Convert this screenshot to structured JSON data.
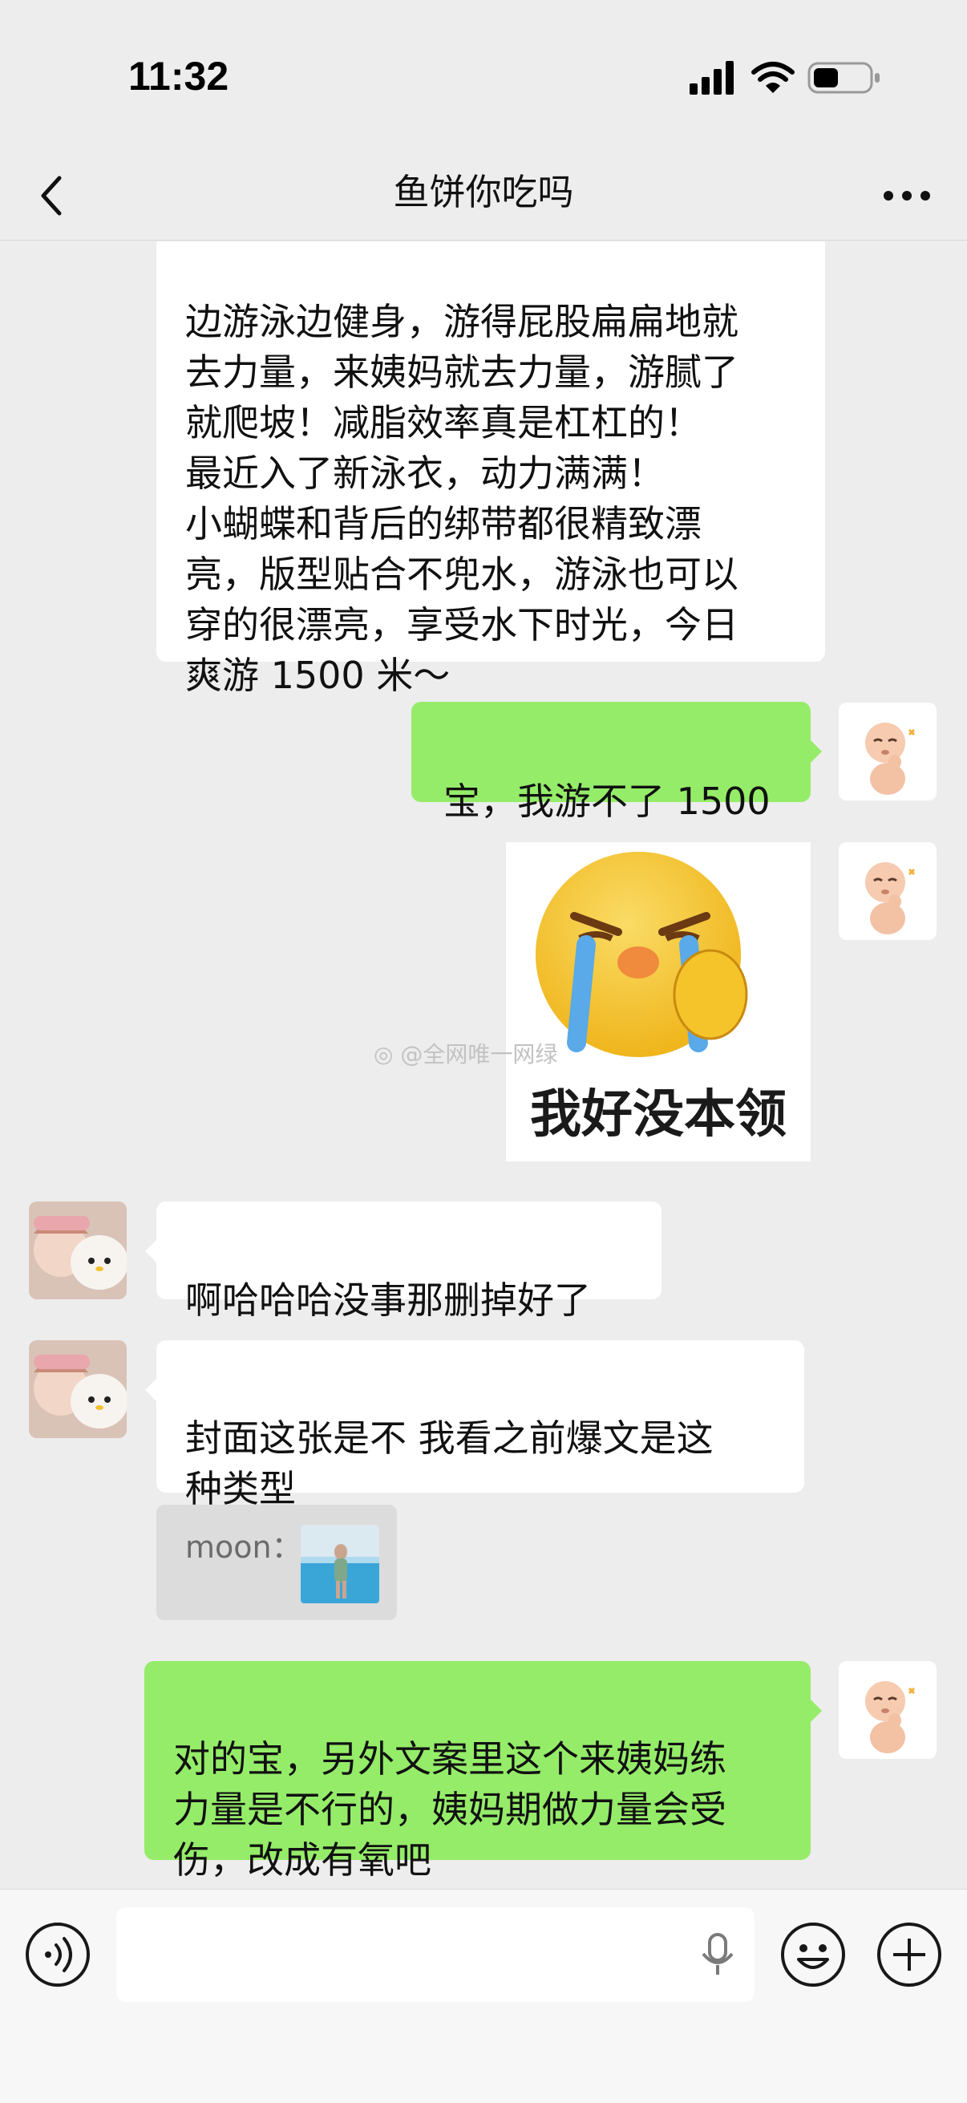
{
  "status_bar": {
    "time": "11:32"
  },
  "header": {
    "title": "鱼饼你吃吗"
  },
  "messages": {
    "m1": {
      "text": "边游泳边健身，游得屁股扁扁地就\n去力量，来姨妈就去力量，游腻了\n就爬坡！减脂效率真是杠杠的！\n最近入了新泳衣，动力满满！\n小蝴蝶和背后的绑带都很精致漂\n亮，版型贴合不兜水，游泳也可以\n穿的很漂亮，享受水下时光，今日\n爽游 1500 米～"
    },
    "m2": {
      "text": "宝，我游不了 1500"
    },
    "m3": {
      "caption": "我好没本领"
    },
    "m4": {
      "text": "啊哈哈哈没事那删掉好了"
    },
    "m5": {
      "text": "封面这张是不  我看之前爆文是这\n种类型"
    },
    "m5_quote": {
      "author": "moon："
    },
    "m6": {
      "text": "对的宝，另外文案里这个来姨妈练\n力量是不行的，姨妈期做力量会受\n伤，改成有氧吧"
    }
  },
  "watermark": "@全网唯一网绿",
  "colors": {
    "green_bubble": "#95ec69",
    "background": "#ededed"
  }
}
